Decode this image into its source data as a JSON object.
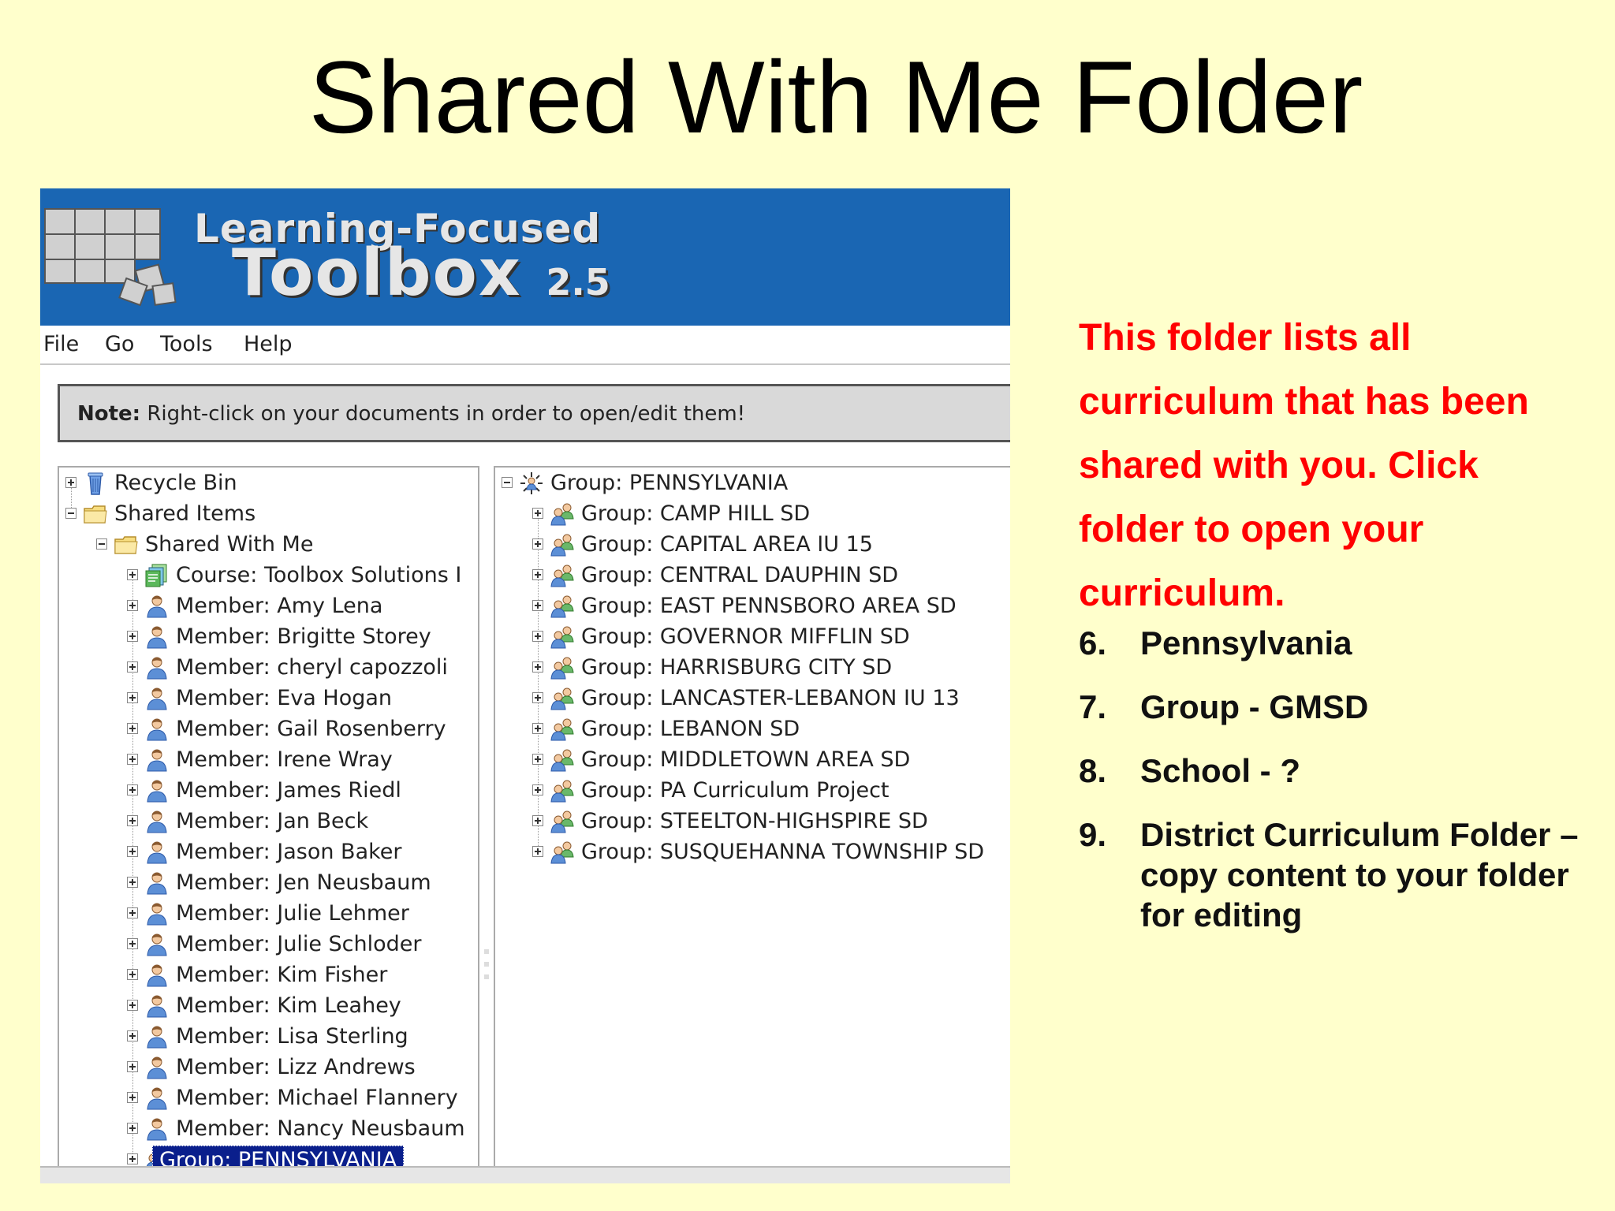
{
  "slide": {
    "title": "Shared With Me Folder",
    "description": "This folder lists all curriculum that has been shared with you. Click folder to open your curriculum.",
    "steps": [
      {
        "num": "6.",
        "text": "Pennsylvania"
      },
      {
        "num": "7.",
        "text": "Group - GMSD"
      },
      {
        "num": "8.",
        "text": "School - ?"
      },
      {
        "num": "9.",
        "text": "District Curriculum Folder – copy content to your folder for editing"
      }
    ]
  },
  "app": {
    "brand_line1": "Learning-Focused",
    "brand_line2": "Toolbox",
    "version": "2.5",
    "colors": {
      "banner": "#1a66b3",
      "selection": "#0a1f8c",
      "alert_text": "#ff0000"
    },
    "menu": [
      "File",
      "Go",
      "Tools",
      "Help"
    ],
    "note": {
      "label": "Note:",
      "text": " Right-click on your documents in order to open/edit them!"
    },
    "left_tree": [
      {
        "label": "Recycle Bin",
        "level": 0,
        "icon": "recycle-bin-icon",
        "expander": "plus"
      },
      {
        "label": "Shared Items",
        "level": 0,
        "icon": "folder-icon",
        "expander": "minus"
      },
      {
        "label": "Shared With Me",
        "level": 1,
        "icon": "folder-icon",
        "expander": "minus"
      },
      {
        "label": "Course: Toolbox Solutions I",
        "level": 2,
        "icon": "course-icon",
        "expander": "plus"
      },
      {
        "label": "Member: Amy Lena",
        "level": 2,
        "icon": "member-icon",
        "expander": "plus"
      },
      {
        "label": "Member: Brigitte Storey",
        "level": 2,
        "icon": "member-icon",
        "expander": "plus"
      },
      {
        "label": "Member: cheryl capozzoli",
        "level": 2,
        "icon": "member-icon",
        "expander": "plus"
      },
      {
        "label": "Member: Eva Hogan",
        "level": 2,
        "icon": "member-icon",
        "expander": "plus"
      },
      {
        "label": "Member: Gail Rosenberry",
        "level": 2,
        "icon": "member-icon",
        "expander": "plus"
      },
      {
        "label": "Member: Irene Wray",
        "level": 2,
        "icon": "member-icon",
        "expander": "plus"
      },
      {
        "label": "Member: James Riedl",
        "level": 2,
        "icon": "member-icon",
        "expander": "plus"
      },
      {
        "label": "Member: Jan Beck",
        "level": 2,
        "icon": "member-icon",
        "expander": "plus"
      },
      {
        "label": "Member: Jason Baker",
        "level": 2,
        "icon": "member-icon",
        "expander": "plus"
      },
      {
        "label": "Member: Jen Neusbaum",
        "level": 2,
        "icon": "member-icon",
        "expander": "plus"
      },
      {
        "label": "Member: Julie Lehmer",
        "level": 2,
        "icon": "member-icon",
        "expander": "plus"
      },
      {
        "label": "Member: Julie Schloder",
        "level": 2,
        "icon": "member-icon",
        "expander": "plus"
      },
      {
        "label": "Member: Kim Fisher",
        "level": 2,
        "icon": "member-icon",
        "expander": "plus"
      },
      {
        "label": "Member: Kim Leahey",
        "level": 2,
        "icon": "member-icon",
        "expander": "plus"
      },
      {
        "label": "Member: Lisa Sterling",
        "level": 2,
        "icon": "member-icon",
        "expander": "plus"
      },
      {
        "label": "Member: Lizz Andrews",
        "level": 2,
        "icon": "member-icon",
        "expander": "plus"
      },
      {
        "label": "Member: Michael Flannery",
        "level": 2,
        "icon": "member-icon",
        "expander": "plus"
      },
      {
        "label": "Member: Nancy Neusbaum",
        "level": 2,
        "icon": "member-icon",
        "expander": "plus"
      },
      {
        "label": "Group: PENNSYLVANIA",
        "level": 2,
        "icon": "group-icon",
        "expander": "plus",
        "selected": true
      }
    ],
    "right_tree": [
      {
        "label": "Group: PENNSYLVANIA",
        "level": 0,
        "icon": "group-root-icon",
        "expander": "minus"
      },
      {
        "label": "Group: CAMP HILL SD",
        "level": 1,
        "icon": "group-icon",
        "expander": "plus"
      },
      {
        "label": "Group: CAPITAL AREA IU 15",
        "level": 1,
        "icon": "group-icon",
        "expander": "plus"
      },
      {
        "label": "Group: CENTRAL DAUPHIN SD",
        "level": 1,
        "icon": "group-icon",
        "expander": "plus"
      },
      {
        "label": "Group: EAST PENNSBORO AREA SD",
        "level": 1,
        "icon": "group-icon",
        "expander": "plus"
      },
      {
        "label": "Group: GOVERNOR MIFFLIN SD",
        "level": 1,
        "icon": "group-icon",
        "expander": "plus"
      },
      {
        "label": "Group: HARRISBURG CITY SD",
        "level": 1,
        "icon": "group-icon",
        "expander": "plus"
      },
      {
        "label": "Group: LANCASTER-LEBANON IU 13",
        "level": 1,
        "icon": "group-icon",
        "expander": "plus"
      },
      {
        "label": "Group: LEBANON SD",
        "level": 1,
        "icon": "group-icon",
        "expander": "plus"
      },
      {
        "label": "Group: MIDDLETOWN AREA SD",
        "level": 1,
        "icon": "group-icon",
        "expander": "plus"
      },
      {
        "label": "Group: PA Curriculum Project",
        "level": 1,
        "icon": "group-icon",
        "expander": "plus"
      },
      {
        "label": "Group: STEELTON-HIGHSPIRE SD",
        "level": 1,
        "icon": "group-icon",
        "expander": "plus"
      },
      {
        "label": "Group: SUSQUEHANNA TOWNSHIP SD",
        "level": 1,
        "icon": "group-icon",
        "expander": "plus"
      }
    ]
  }
}
